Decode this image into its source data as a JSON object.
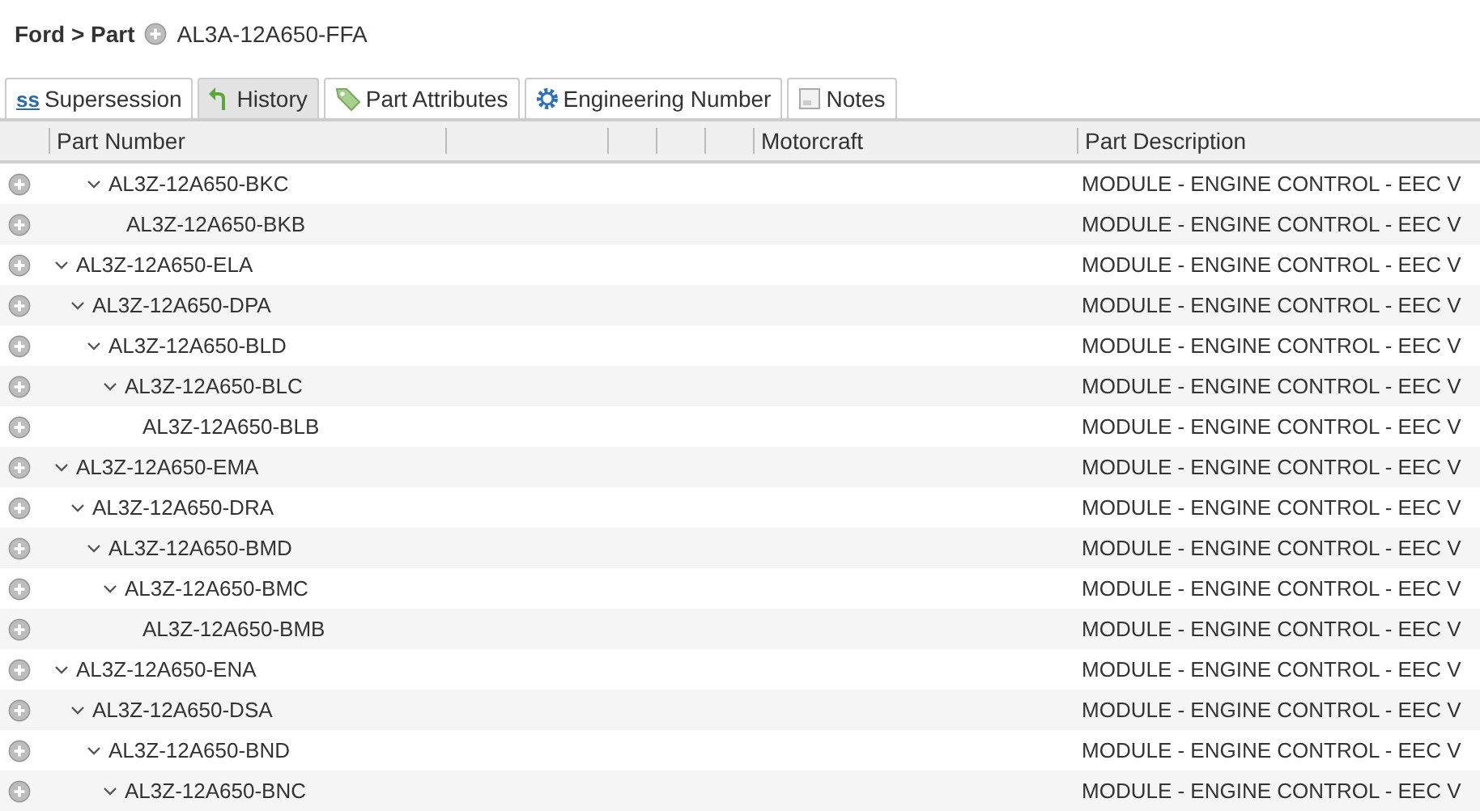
{
  "breadcrumb": {
    "path": "Ford > Part",
    "part": "AL3A-12A650-FFA"
  },
  "tabs": [
    {
      "label": "Supersession",
      "icon_text": "ss",
      "kind": "text",
      "selected": false
    },
    {
      "label": "History",
      "kind": "history",
      "selected": true
    },
    {
      "label": "Part Attributes",
      "kind": "tag",
      "selected": false
    },
    {
      "label": "Engineering Number",
      "kind": "gear",
      "selected": false
    },
    {
      "label": "Notes",
      "kind": "note",
      "selected": false
    }
  ],
  "table": {
    "columns": [
      "Part Number",
      "Motorcraft",
      "Part Description"
    ],
    "rows": [
      {
        "children": [
          {
            "children": [
              {
                "part_number": "AL3Z-12A650-BKC",
                "description": "MODULE - ENGINE CONTROL - EEC V",
                "expanded": true,
                "children": [
                  {
                    "part_number": "AL3Z-12A650-BKB",
                    "description": "MODULE - ENGINE CONTROL - EEC V"
                  }
                ]
              }
            ]
          }
        ]
      },
      {
        "part_number": "AL3Z-12A650-ELA",
        "description": "MODULE - ENGINE CONTROL - EEC V",
        "expanded": true,
        "children": [
          {
            "part_number": "AL3Z-12A650-DPA",
            "description": "MODULE - ENGINE CONTROL - EEC V",
            "expanded": true,
            "children": [
              {
                "part_number": "AL3Z-12A650-BLD",
                "description": "MODULE - ENGINE CONTROL - EEC V",
                "expanded": true,
                "children": [
                  {
                    "part_number": "AL3Z-12A650-BLC",
                    "description": "MODULE - ENGINE CONTROL - EEC V",
                    "expanded": true,
                    "children": [
                      {
                        "part_number": "AL3Z-12A650-BLB",
                        "description": "MODULE - ENGINE CONTROL - EEC V"
                      }
                    ]
                  }
                ]
              }
            ]
          }
        ]
      },
      {
        "part_number": "AL3Z-12A650-EMA",
        "description": "MODULE - ENGINE CONTROL - EEC V",
        "expanded": true,
        "children": [
          {
            "part_number": "AL3Z-12A650-DRA",
            "description": "MODULE - ENGINE CONTROL - EEC V",
            "expanded": true,
            "children": [
              {
                "part_number": "AL3Z-12A650-BMD",
                "description": "MODULE - ENGINE CONTROL - EEC V",
                "expanded": true,
                "children": [
                  {
                    "part_number": "AL3Z-12A650-BMC",
                    "description": "MODULE - ENGINE CONTROL - EEC V",
                    "expanded": true,
                    "children": [
                      {
                        "part_number": "AL3Z-12A650-BMB",
                        "description": "MODULE - ENGINE CONTROL - EEC V"
                      }
                    ]
                  }
                ]
              }
            ]
          }
        ]
      },
      {
        "part_number": "AL3Z-12A650-ENA",
        "description": "MODULE - ENGINE CONTROL - EEC V",
        "expanded": true,
        "children": [
          {
            "part_number": "AL3Z-12A650-DSA",
            "description": "MODULE - ENGINE CONTROL - EEC V",
            "expanded": true,
            "children": [
              {
                "part_number": "AL3Z-12A650-BND",
                "description": "MODULE - ENGINE CONTROL - EEC V",
                "expanded": true,
                "children": [
                  {
                    "part_number": "AL3Z-12A650-BNC",
                    "description": "MODULE - ENGINE CONTROL - EEC V",
                    "expanded": true
                  }
                ]
              }
            ]
          }
        ]
      }
    ]
  }
}
